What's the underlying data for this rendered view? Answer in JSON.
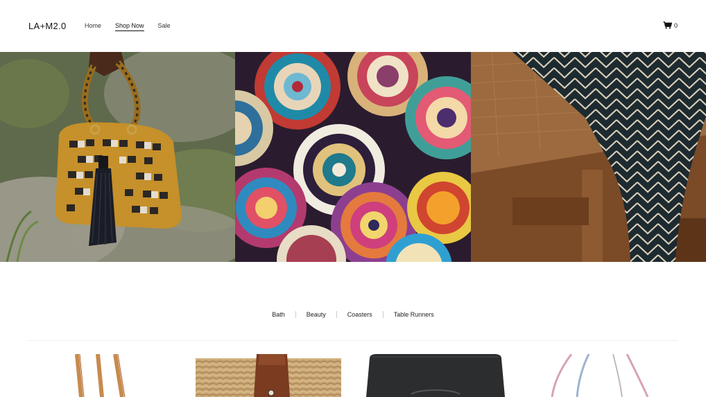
{
  "header": {
    "logo": "LA+M2.0",
    "nav": [
      {
        "label": "Home"
      },
      {
        "label": "Shop Now"
      },
      {
        "label": "Sale"
      }
    ],
    "cart_count": "0"
  },
  "hero": {
    "panels": [
      {
        "name": "crochet-handbag-photo"
      },
      {
        "name": "woven-coasters-photo"
      },
      {
        "name": "table-runner-photo"
      }
    ]
  },
  "filters": [
    {
      "label": "Bath"
    },
    {
      "label": "Beauty"
    },
    {
      "label": "Coasters"
    },
    {
      "label": "Table Runners"
    }
  ],
  "products": [
    {
      "name": "tan-leather-tote"
    },
    {
      "name": "straw-bag-brown-strap"
    },
    {
      "name": "black-leather-saddle-bag"
    },
    {
      "name": "pastel-strap-bag"
    }
  ]
}
